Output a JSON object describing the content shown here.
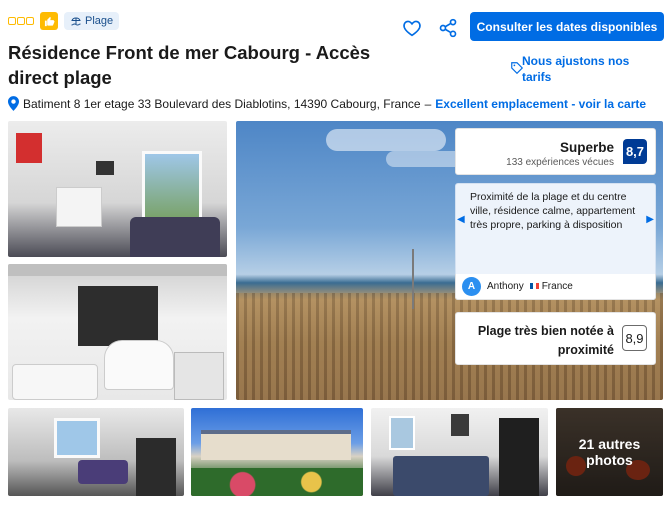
{
  "header": {
    "star_count": 3,
    "beach_badge": "Plage",
    "title": "Résidence Front de mer Cabourg - Accès direct plage",
    "address": "Batiment 8 1er etage 33 Boulevard des Diablotins, 14390 Cabourg, France",
    "separator": "–",
    "location_link": "Excellent emplacement - voir la carte"
  },
  "actions": {
    "heart_icon": "heart-outline-icon",
    "share_icon": "share-icon",
    "cta_label": "Consulter les dates disponibles",
    "price_match_label": "Nous ajustons nos tarifs",
    "price_match_icon": "price-tag-icon"
  },
  "review_summary": {
    "rating_word": "Superbe",
    "reviews_count": "133 expériences vécues",
    "score": "8,7"
  },
  "featured_review": {
    "text": "Proximité de la plage et du centre ville, résidence calme, appartement très propre, parking à disposition",
    "reviewer_initial": "A",
    "reviewer_name": "Anthony",
    "reviewer_country": "France",
    "prev_icon": "chevron-left-icon",
    "next_icon": "chevron-right-icon"
  },
  "location_score": {
    "label": "Plage très bien notée à proximité",
    "score": "8,9"
  },
  "gallery": {
    "more_count": "21 autres",
    "more_label": "photos"
  },
  "colors": {
    "brand_blue": "#006ce4",
    "score_navy": "#003b95",
    "star_yellow": "#febb02"
  }
}
